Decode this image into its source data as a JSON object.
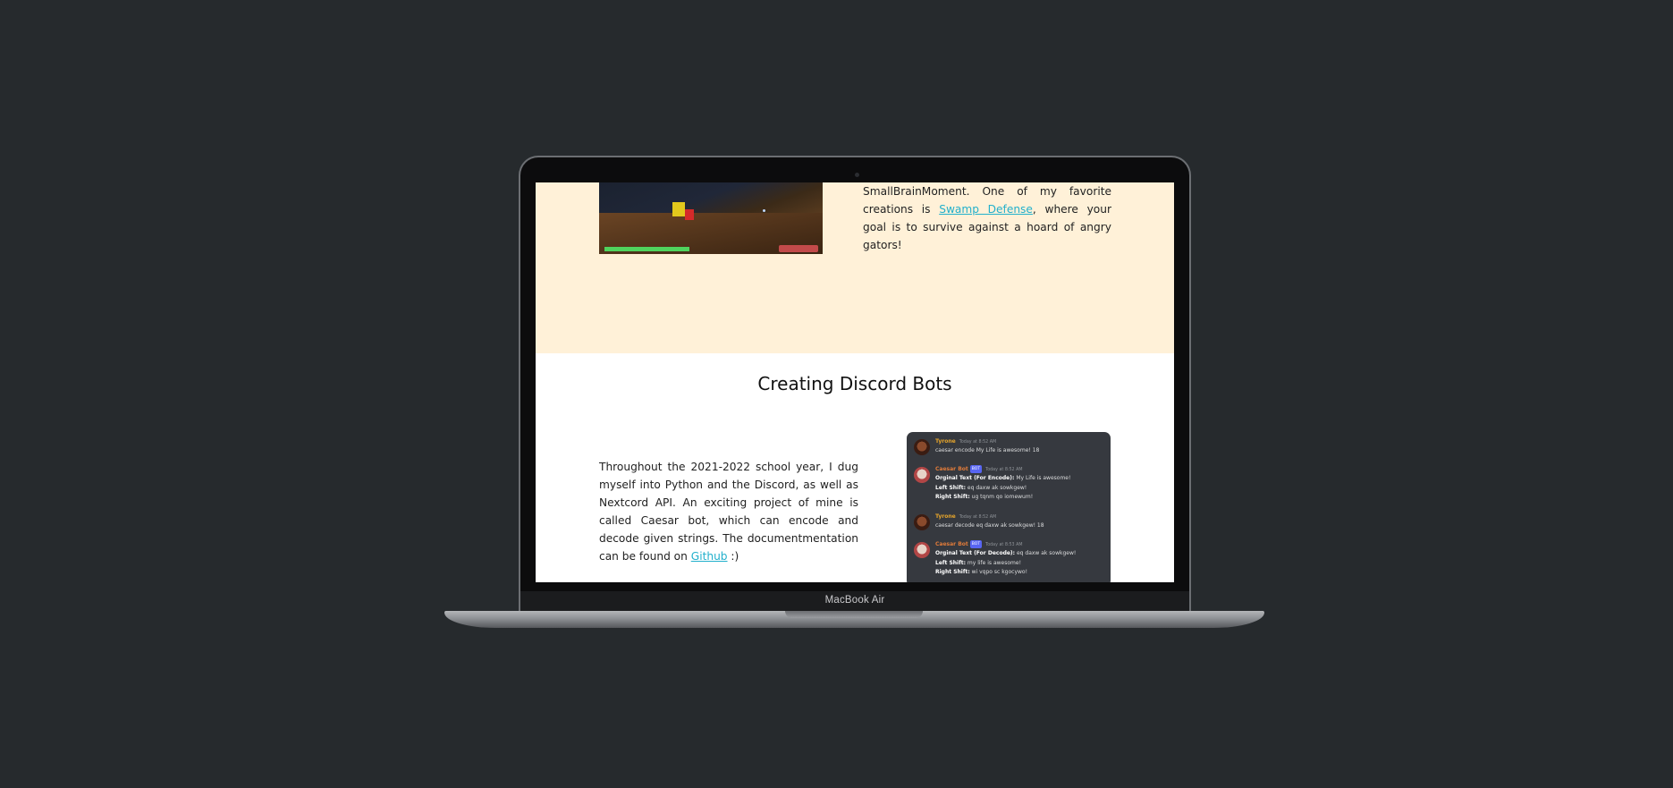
{
  "device": {
    "label": "MacBook Air"
  },
  "games_section": {
    "text_before": "SmallBrainMoment. One of my favorite creations is ",
    "link": "Swamp Defense",
    "text_after": ", where your goal is to survive against a hoard of angry gators!"
  },
  "bots_section": {
    "title": "Creating Discord Bots",
    "text_before": "Throughout the 2021-2022 school year, I dug myself into Python and the Discord, as well as Nextcord API. An exciting project of mine is called Caesar bot, which can encode and decode given strings. The documentmentation can be found on ",
    "link": "Github",
    "text_after": " :)"
  },
  "discord_chat": {
    "messages": [
      {
        "author": "Tyrone",
        "timestamp": "Today at 8:52 AM",
        "lines": [
          {
            "label": "",
            "text": "caesar encode My Life is awesome! 18"
          }
        ]
      },
      {
        "author": "Caesar Bot",
        "bot_tag": "BOT",
        "timestamp": "Today at 8:52 AM",
        "lines": [
          {
            "label": "Orginal Text (For Encode):",
            "text": " My Life is awesome!"
          },
          {
            "label": "Left Shift:",
            "text": " eq daxw ak sowkgew!"
          },
          {
            "label": "Right Shift:",
            "text": " ug tqnm qo iomewum!"
          }
        ]
      },
      {
        "author": "Tyrone",
        "timestamp": "Today at 8:52 AM",
        "lines": [
          {
            "label": "",
            "text": "caesar decode eq daxw ak sowkgew! 18"
          }
        ]
      },
      {
        "author": "Caesar Bot",
        "bot_tag": "BOT",
        "timestamp": "Today at 8:53 AM",
        "lines": [
          {
            "label": "Orginal Text (For Decode):",
            "text": " eq daxw ak sowkgew!"
          },
          {
            "label": "Left Shift:",
            "text": " my life is awesome!"
          },
          {
            "label": "Right Shift:",
            "text": " wi vqpo sc kgocywo!"
          }
        ]
      }
    ]
  },
  "colors": {
    "background": "#262a2d",
    "games_section_bg": "#fff1d8",
    "link": "#22b0cc",
    "discord_bg": "#36393f"
  }
}
